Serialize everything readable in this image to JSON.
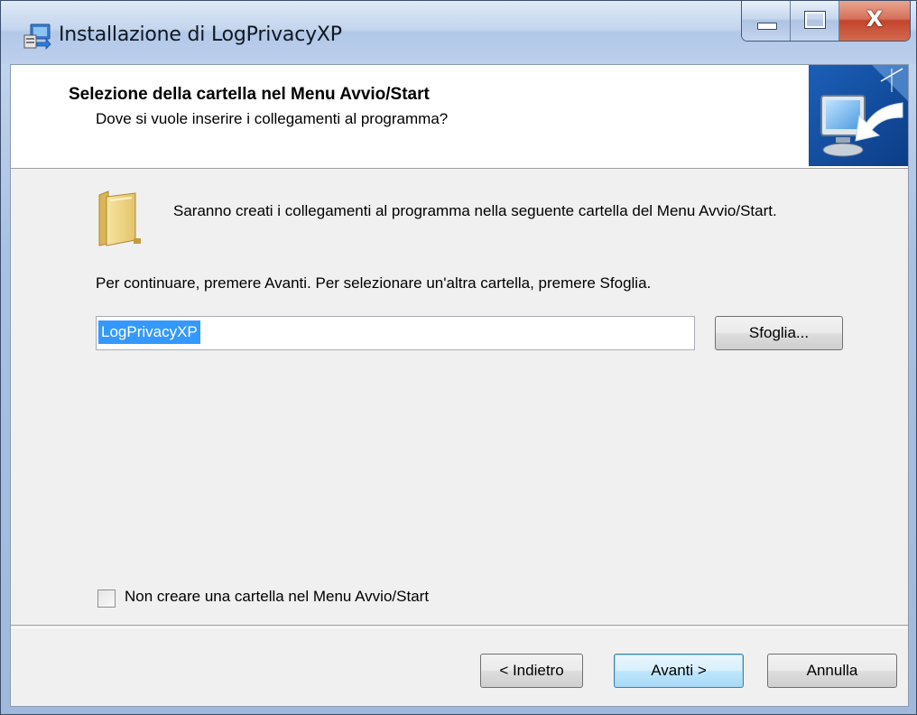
{
  "window": {
    "title": "Installazione di LogPrivacyXP",
    "icon": "installer-icon",
    "controls": {
      "minimize": "minimize-icon",
      "maximize": "maximize-icon",
      "close_glyph": "X"
    }
  },
  "header": {
    "title": "Selezione della cartella nel Menu Avvio/Start",
    "subtitle": "Dove si vuole inserire i collegamenti al programma?",
    "image": "wizard-computer-icon"
  },
  "main": {
    "folder_icon": "folder-icon",
    "intro": "Saranno creati i collegamenti al programma nella seguente cartella del Menu Avvio/Start.",
    "instruction": "Per continuare, premere Avanti. Per selezionare un'altra cartella, premere Sfoglia.",
    "folder_input": {
      "value": "LogPrivacyXP",
      "selected": true
    },
    "browse_label": "Sfoglia...",
    "no_folder_checkbox": {
      "label": "Non creare una cartella nel Menu Avvio/Start",
      "checked": false
    }
  },
  "footer": {
    "back_label": "< Indietro",
    "next_label": "Avanti >",
    "cancel_label": "Annulla"
  }
}
